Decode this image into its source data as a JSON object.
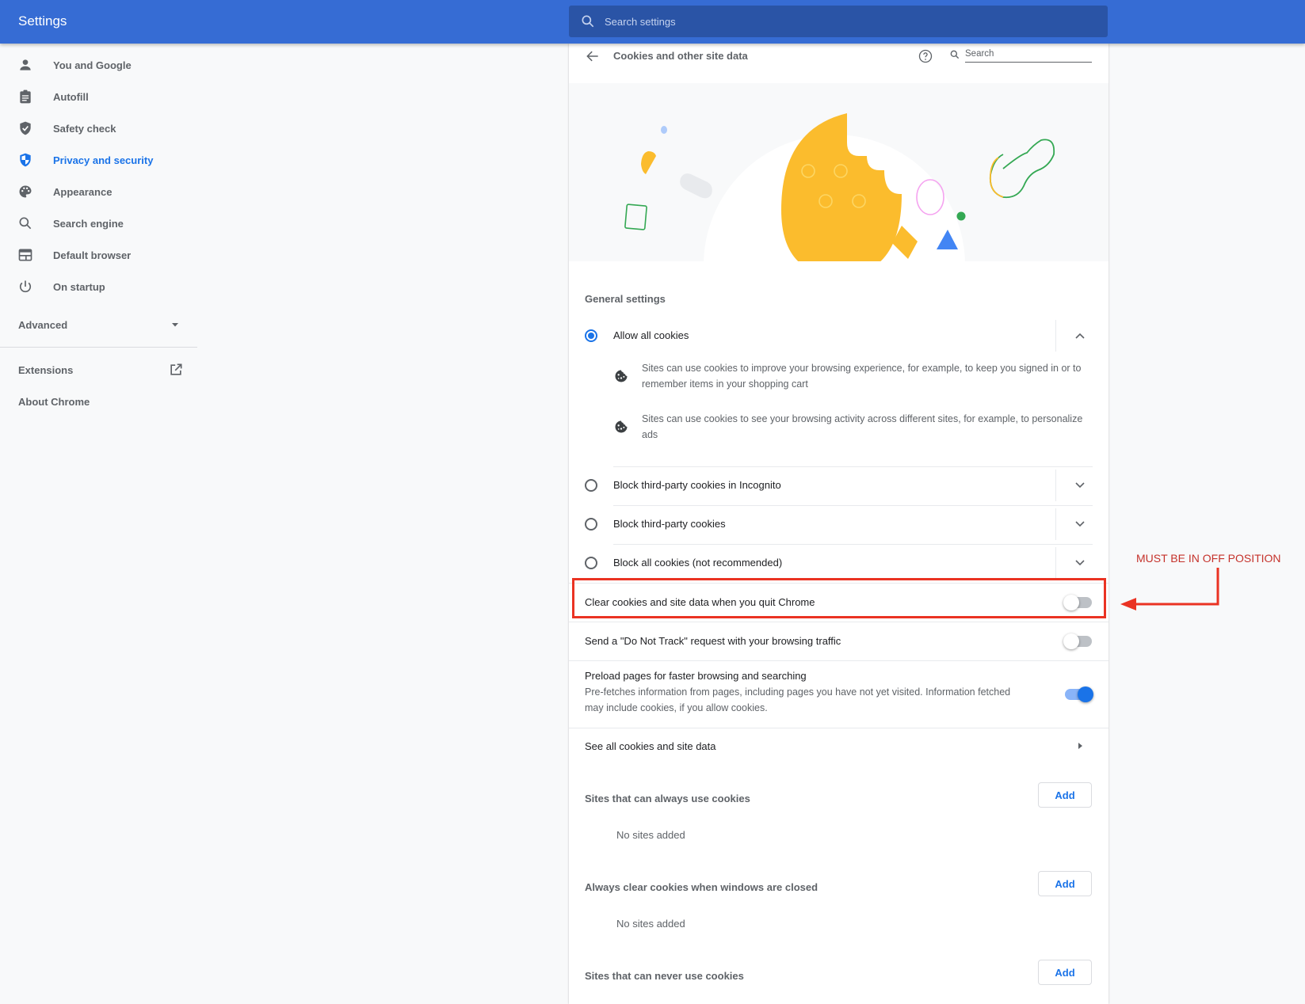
{
  "header": {
    "title": "Settings",
    "search_placeholder": "Search settings"
  },
  "sidebar": {
    "items": [
      {
        "label": "You and Google",
        "icon": "person-icon",
        "active": false
      },
      {
        "label": "Autofill",
        "icon": "clipboard-icon",
        "active": false
      },
      {
        "label": "Safety check",
        "icon": "shield-check-icon",
        "active": false
      },
      {
        "label": "Privacy and security",
        "icon": "shield-half-icon",
        "active": true
      },
      {
        "label": "Appearance",
        "icon": "palette-icon",
        "active": false
      },
      {
        "label": "Search engine",
        "icon": "search-icon",
        "active": false
      },
      {
        "label": "Default browser",
        "icon": "browser-window-icon",
        "active": false
      },
      {
        "label": "On startup",
        "icon": "power-icon",
        "active": false
      }
    ],
    "advanced_label": "Advanced",
    "extensions_label": "Extensions",
    "about_label": "About Chrome"
  },
  "page": {
    "title": "Cookies and other site data",
    "search_placeholder": "Search",
    "general_settings_title": "General settings",
    "cookie_options": [
      {
        "label": "Allow all cookies",
        "selected": true,
        "expanded": true
      },
      {
        "label": "Block third-party cookies in Incognito",
        "selected": false,
        "expanded": false
      },
      {
        "label": "Block third-party cookies",
        "selected": false,
        "expanded": false
      },
      {
        "label": "Block all cookies (not recommended)",
        "selected": false,
        "expanded": false
      }
    ],
    "allow_details": [
      "Sites can use cookies to improve your browsing experience, for example, to keep you signed in or to remember items in your shopping cart",
      "Sites can use cookies to see your browsing activity across different sites, for example, to personalize ads"
    ],
    "toggles": [
      {
        "label": "Clear cookies and site data when you quit Chrome",
        "on": false
      },
      {
        "label": "Send a \"Do Not Track\" request with your browsing traffic",
        "on": false
      },
      {
        "label": "Preload pages for faster browsing and searching",
        "sublabel": "Pre-fetches information from pages, including pages you have not yet visited. Information fetched may include cookies, if you allow cookies.",
        "on": true
      }
    ],
    "see_all_label": "See all cookies and site data",
    "site_lists": [
      {
        "title": "Sites that can always use cookies",
        "button": "Add",
        "empty": "No sites added"
      },
      {
        "title": "Always clear cookies when windows are closed",
        "button": "Add",
        "empty": "No sites added"
      },
      {
        "title": "Sites that can never use cookies",
        "button": "Add"
      }
    ]
  },
  "annotation": {
    "text": "MUST BE IN OFF POSITION",
    "color": "#ea3323"
  },
  "colors": {
    "header_bg": "#366cd4",
    "accent": "#1a73e8",
    "cookie_yellow": "#fbbc2d"
  }
}
